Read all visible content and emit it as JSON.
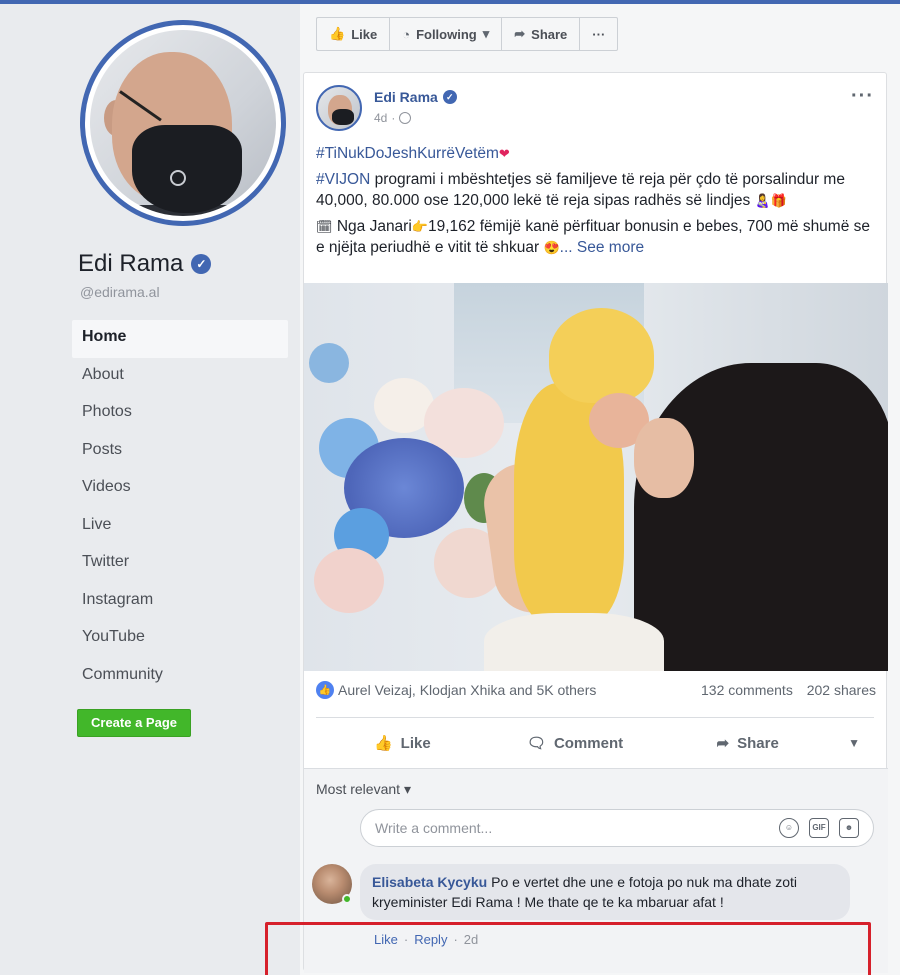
{
  "page": {
    "name": "Edi Rama",
    "handle": "@edirama.al"
  },
  "nav": {
    "items": [
      "Home",
      "About",
      "Photos",
      "Posts",
      "Videos",
      "Live",
      "Twitter",
      "Instagram",
      "YouTube",
      "Community"
    ],
    "active": "Home",
    "create_page": "Create a Page"
  },
  "action_bar": {
    "like": "Like",
    "following": "Following",
    "share": "Share",
    "more": "···"
  },
  "post": {
    "author": "Edi Rama",
    "time": "4d",
    "menu": "···",
    "hashtag": "#TiNukDoJeshKurrëVetëm",
    "para1_tag": "#VIJON",
    "para1_text": " programi i mbështetjes së familjeve të reja për çdo të porsalindur me 40,000, 80.000 ose 120,000 lekë të reja sipas radhës së lindjes",
    "para2_text": "Nga Janari",
    "para2_text_b": "19,162 fëmijë kanë përfituar bonusin e bebes, 700 më shumë se e njëjta periudhë e vitit të shkuar",
    "see_more": "... See more",
    "reactions_names": "Aurel Veizaj, Klodjan Xhika and 5K others",
    "comments_count": "132 comments",
    "shares_count": "202 shares",
    "actions": {
      "like": "Like",
      "comment": "Comment",
      "share": "Share"
    }
  },
  "comments": {
    "sort": "Most relevant",
    "input_placeholder": "Write a comment...",
    "items": [
      {
        "author": "Elisabeta Kycyku",
        "text": "Po e vertet dhe une e fotoja po nuk ma dhate zoti kryeminister Edi Rama ! Me thate qe te ka mbaruar afat !",
        "like": "Like",
        "reply": "Reply",
        "time": "2d"
      }
    ]
  },
  "colors": {
    "brand": "#4267b2",
    "link": "#385898",
    "create_button": "#42b72a",
    "highlight_box": "#d6202b"
  },
  "icons": [
    "verified-badge-icon",
    "thumbs-up-icon",
    "rss-icon",
    "share-arrow-icon",
    "more-dots-icon",
    "globe-icon",
    "comment-icon",
    "caret-down-icon",
    "emoji-icon",
    "gif-icon",
    "sticker-icon"
  ]
}
